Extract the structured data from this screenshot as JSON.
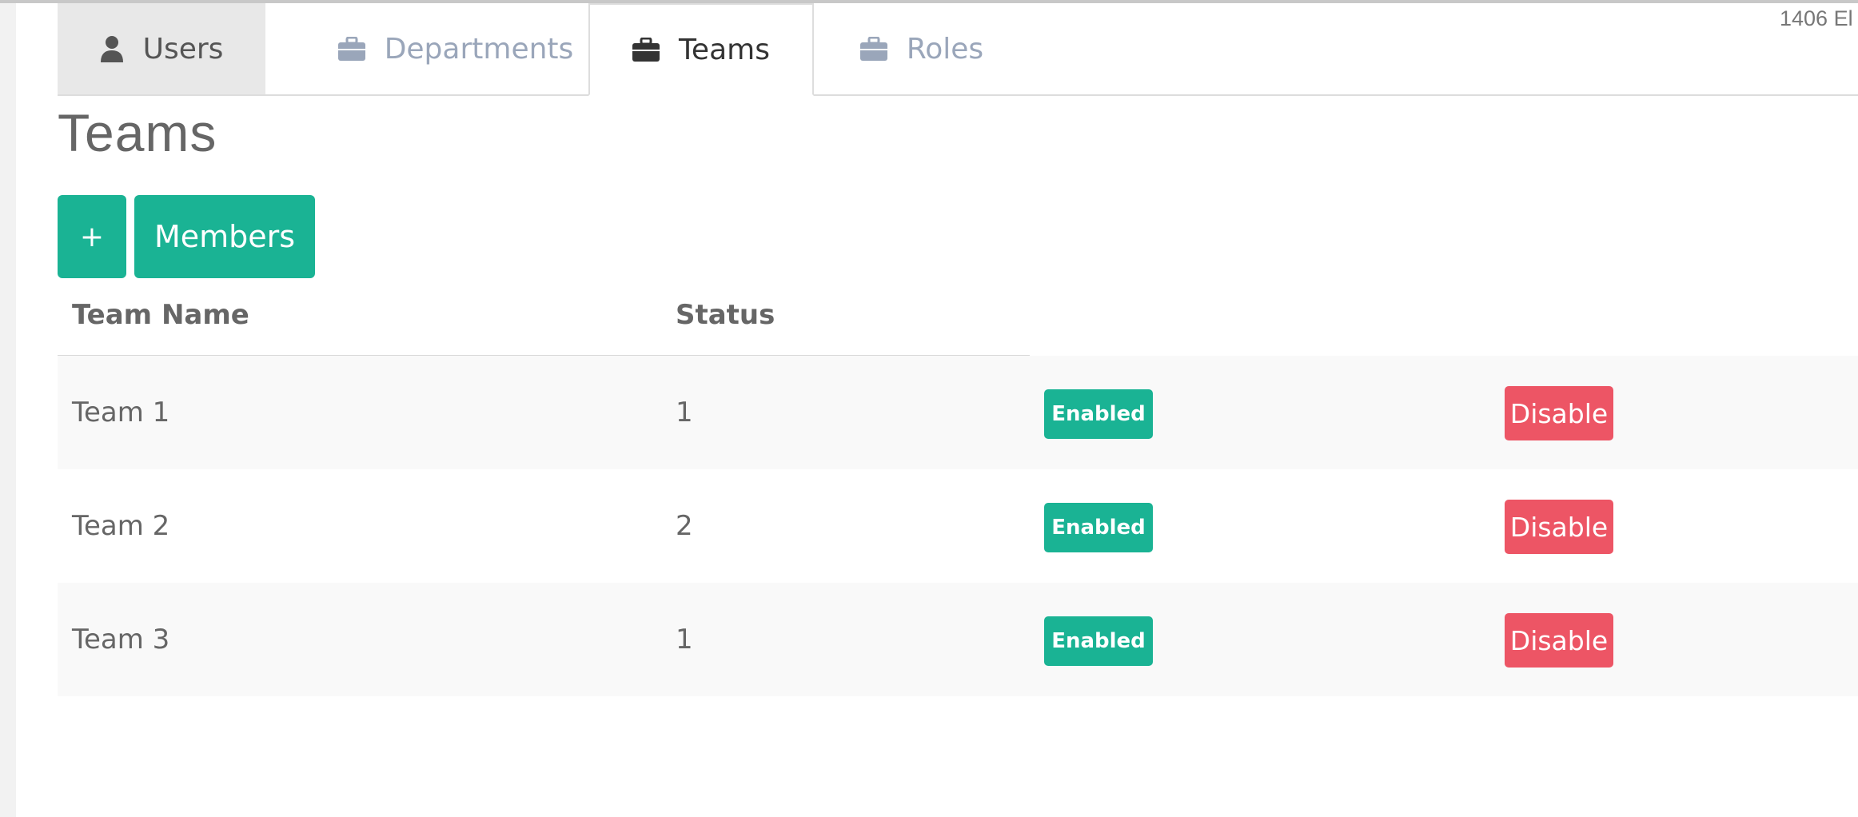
{
  "corner_text": "1406 El",
  "tabs": [
    {
      "label": "Users",
      "icon": "user-icon",
      "state": "inactive"
    },
    {
      "label": "Departments",
      "icon": "briefcase-icon",
      "state": "inactive"
    },
    {
      "label": "Teams",
      "icon": "briefcase-icon",
      "state": "active"
    },
    {
      "label": "Roles",
      "icon": "briefcase-icon",
      "state": "inactive"
    }
  ],
  "page": {
    "title": "Teams"
  },
  "toolbar": {
    "add_label": "+",
    "members_label": "Members"
  },
  "table": {
    "columns": [
      "Team Name",
      "Status"
    ],
    "rows": [
      {
        "name": "Team 1",
        "status": "1",
        "badge": "Enabled",
        "action": "Disable"
      },
      {
        "name": "Team 2",
        "status": "2",
        "badge": "Enabled",
        "action": "Disable"
      },
      {
        "name": "Team 3",
        "status": "1",
        "badge": "Enabled",
        "action": "Disable"
      }
    ]
  },
  "colors": {
    "primary": "#1ab394",
    "danger": "#ed5565",
    "tab_inactive_text": "#9aa6ba"
  }
}
